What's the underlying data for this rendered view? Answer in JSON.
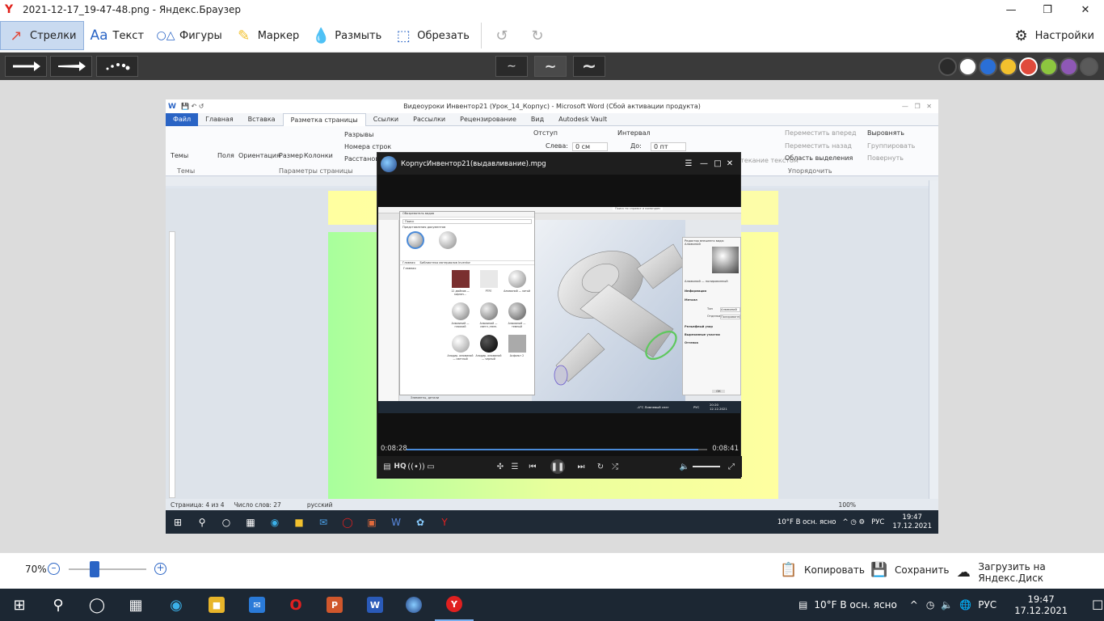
{
  "window": {
    "title": "2021-12-17_19-47-48.png - Яндекс.Браузер"
  },
  "toolbar": {
    "arrows_label": "Стрелки",
    "text_label": "Текст",
    "shapes_label": "Фигуры",
    "marker_label": "Маркер",
    "blur_label": "Размыть",
    "crop_label": "Обрезать",
    "settings_label": "Настройки"
  },
  "colors": {
    "palette": [
      "#2b2b2b",
      "#ffffff",
      "#2a6fd6",
      "#f2c12e",
      "#e04a3c",
      "#8dc63f",
      "#8e58b5",
      "#5a5a5a"
    ],
    "selected": "#e04a3c",
    "accent": "#2a64c5"
  },
  "word": {
    "title": "Видеоуроки Инвентор21 (Урок_14_Корпус) - Microsoft Word (Сбой активации продукта)",
    "tabs": [
      "Файл",
      "Главная",
      "Вставка",
      "Разметка страницы",
      "Ссылки",
      "Рассылки",
      "Рецензирование",
      "Вид",
      "Autodesk Vault"
    ],
    "active_tab": "Разметка страницы",
    "ribbon": {
      "themes": "Темы",
      "margins": "Поля",
      "orientation": "Ориентация",
      "size": "Размер",
      "columns": "Колонки",
      "breaks": "Разрывы",
      "line_numbers": "Номера строк",
      "hyphenation": "Расстановка",
      "group_page": "Параметры страницы",
      "group_themes": "Темы",
      "indent": "Отступ",
      "indent_left": "Слева:",
      "indent_left_val": "0 см",
      "spacing": "Интервал",
      "spacing_before": "До:",
      "spacing_before_val": "0 пт",
      "bring_forward": "Переместить вперед",
      "send_back": "Переместить назад",
      "selection_pane": "Область выделения",
      "align": "Выровнять",
      "group": "Группировать",
      "rotate": "Повернуть",
      "wrap": "Обтекание текстом",
      "group_arrange": "Упорядочить"
    },
    "status": {
      "page": "Страница: 4 из 4",
      "words": "Число слов: 27",
      "lang": "русский",
      "zoom": "100%"
    },
    "taskbar": {
      "weather": "10°F  В осн. ясно",
      "lang": "РУС",
      "time": "19:47",
      "date": "17.12.2021"
    }
  },
  "player": {
    "title": "КорпусИнвентор21(выдавливание).mpg",
    "elapsed": "0:08:28",
    "total": "0:08:41",
    "progress_fraction": 0.97,
    "quality": "HQ"
  },
  "inner_frame": {
    "dialog_title": "Обозреватель видов",
    "search_placeholder": "Поиск",
    "doc_appearances": "Представления документов",
    "library": "Библиотека материалов Inventor",
    "library_tab": "Главная",
    "favorites": "Главная",
    "materials": [
      "12 дюймов — кирпич...",
      "PTFE",
      "Алюминий — литой",
      "Алюминий — плоский",
      "Алюминий — светл.,темн.",
      "Алюминий — темный",
      "Анодир. алюминий — светлый",
      "Анодир. алюминий — черный",
      "Асфальт 2"
    ],
    "props_title": "Редактор внешнего вида: Алюминий",
    "props_name": "Алюминий — полированный",
    "props_info": "Информация",
    "props_metal": "Металл",
    "props_type_label": "Тип",
    "props_type_val": "Алюминий",
    "props_finish_label": "Отделка",
    "props_finish_val": "Полированный",
    "props_relief": "Рельефный узор",
    "props_cutout": "Вырезанные участки",
    "props_tint": "Оттенок",
    "props_ok": "ОК",
    "inner_weather": "-4°C  Ливневый снег",
    "inner_lang": "РУС",
    "inner_time": "20:20",
    "inner_date": "12.12.2021",
    "bottom_label": "Элементы, детали",
    "top_hint": "Поиск по справке и командам"
  },
  "bottom": {
    "zoom": "70%",
    "zoom_fraction": 0.33,
    "copy": "Копировать",
    "save": "Сохранить",
    "upload": "Загрузить на Яндекс.Диск"
  },
  "taskbar": {
    "weather": "10°F  В осн. ясно",
    "lang": "РУС",
    "time": "19:47",
    "date": "17.12.2021"
  }
}
